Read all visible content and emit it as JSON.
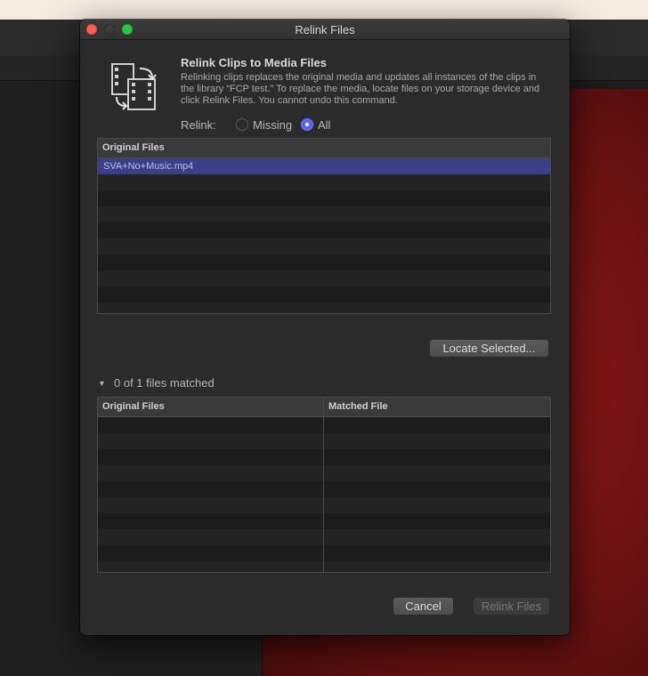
{
  "dialog": {
    "title": "Relink Files",
    "heading": "Relink Clips to Media Files",
    "description": "Relinking clips replaces the original media and updates all instances of the clips in the library “FCP test.” To replace the media, locate files on your storage device and click Relink Files. You cannot undo this command.",
    "relink_label": "Relink:",
    "relink_options": [
      "Missing",
      "All"
    ],
    "relink_selected": "All",
    "original_files_header": "Original Files",
    "original_files": [
      "SVA+No+Music.mp4"
    ],
    "locate_button": "Locate Selected...",
    "matched_summary": "0 of 1 files matched",
    "matched_table": {
      "col_original": "Original Files",
      "col_matched": "Matched File"
    },
    "cancel_button": "Cancel",
    "relink_button": "Relink Files"
  },
  "colors": {
    "selection": "#3b3f87",
    "radio_accent": "#5a64f0",
    "viewer_red": "#7a1414"
  }
}
